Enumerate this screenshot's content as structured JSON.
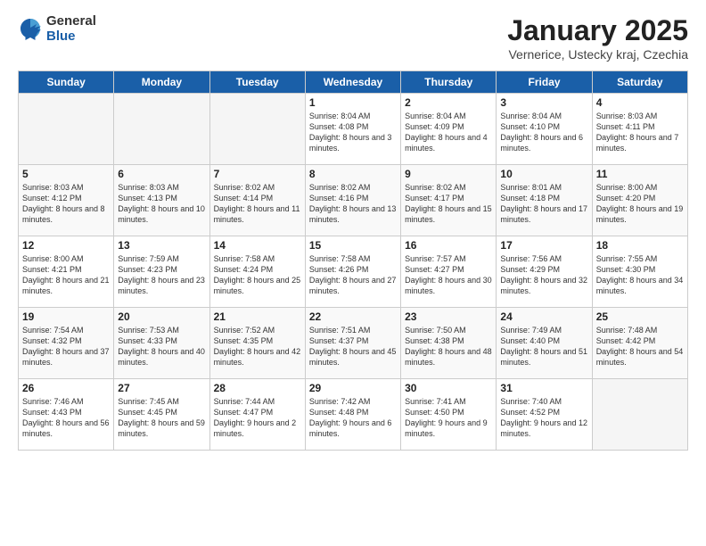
{
  "logo": {
    "general": "General",
    "blue": "Blue"
  },
  "header": {
    "title": "January 2025",
    "subtitle": "Vernerice, Ustecky kraj, Czechia"
  },
  "days_of_week": [
    "Sunday",
    "Monday",
    "Tuesday",
    "Wednesday",
    "Thursday",
    "Friday",
    "Saturday"
  ],
  "weeks": [
    [
      {
        "day": "",
        "empty": true
      },
      {
        "day": "",
        "empty": true
      },
      {
        "day": "",
        "empty": true
      },
      {
        "day": "1",
        "sunrise": "8:04 AM",
        "sunset": "4:08 PM",
        "daylight": "8 hours and 3 minutes."
      },
      {
        "day": "2",
        "sunrise": "8:04 AM",
        "sunset": "4:09 PM",
        "daylight": "8 hours and 4 minutes."
      },
      {
        "day": "3",
        "sunrise": "8:04 AM",
        "sunset": "4:10 PM",
        "daylight": "8 hours and 6 minutes."
      },
      {
        "day": "4",
        "sunrise": "8:03 AM",
        "sunset": "4:11 PM",
        "daylight": "8 hours and 7 minutes."
      }
    ],
    [
      {
        "day": "5",
        "sunrise": "8:03 AM",
        "sunset": "4:12 PM",
        "daylight": "8 hours and 8 minutes."
      },
      {
        "day": "6",
        "sunrise": "8:03 AM",
        "sunset": "4:13 PM",
        "daylight": "8 hours and 10 minutes."
      },
      {
        "day": "7",
        "sunrise": "8:02 AM",
        "sunset": "4:14 PM",
        "daylight": "8 hours and 11 minutes."
      },
      {
        "day": "8",
        "sunrise": "8:02 AM",
        "sunset": "4:16 PM",
        "daylight": "8 hours and 13 minutes."
      },
      {
        "day": "9",
        "sunrise": "8:02 AM",
        "sunset": "4:17 PM",
        "daylight": "8 hours and 15 minutes."
      },
      {
        "day": "10",
        "sunrise": "8:01 AM",
        "sunset": "4:18 PM",
        "daylight": "8 hours and 17 minutes."
      },
      {
        "day": "11",
        "sunrise": "8:00 AM",
        "sunset": "4:20 PM",
        "daylight": "8 hours and 19 minutes."
      }
    ],
    [
      {
        "day": "12",
        "sunrise": "8:00 AM",
        "sunset": "4:21 PM",
        "daylight": "8 hours and 21 minutes."
      },
      {
        "day": "13",
        "sunrise": "7:59 AM",
        "sunset": "4:23 PM",
        "daylight": "8 hours and 23 minutes."
      },
      {
        "day": "14",
        "sunrise": "7:58 AM",
        "sunset": "4:24 PM",
        "daylight": "8 hours and 25 minutes."
      },
      {
        "day": "15",
        "sunrise": "7:58 AM",
        "sunset": "4:26 PM",
        "daylight": "8 hours and 27 minutes."
      },
      {
        "day": "16",
        "sunrise": "7:57 AM",
        "sunset": "4:27 PM",
        "daylight": "8 hours and 30 minutes."
      },
      {
        "day": "17",
        "sunrise": "7:56 AM",
        "sunset": "4:29 PM",
        "daylight": "8 hours and 32 minutes."
      },
      {
        "day": "18",
        "sunrise": "7:55 AM",
        "sunset": "4:30 PM",
        "daylight": "8 hours and 34 minutes."
      }
    ],
    [
      {
        "day": "19",
        "sunrise": "7:54 AM",
        "sunset": "4:32 PM",
        "daylight": "8 hours and 37 minutes."
      },
      {
        "day": "20",
        "sunrise": "7:53 AM",
        "sunset": "4:33 PM",
        "daylight": "8 hours and 40 minutes."
      },
      {
        "day": "21",
        "sunrise": "7:52 AM",
        "sunset": "4:35 PM",
        "daylight": "8 hours and 42 minutes."
      },
      {
        "day": "22",
        "sunrise": "7:51 AM",
        "sunset": "4:37 PM",
        "daylight": "8 hours and 45 minutes."
      },
      {
        "day": "23",
        "sunrise": "7:50 AM",
        "sunset": "4:38 PM",
        "daylight": "8 hours and 48 minutes."
      },
      {
        "day": "24",
        "sunrise": "7:49 AM",
        "sunset": "4:40 PM",
        "daylight": "8 hours and 51 minutes."
      },
      {
        "day": "25",
        "sunrise": "7:48 AM",
        "sunset": "4:42 PM",
        "daylight": "8 hours and 54 minutes."
      }
    ],
    [
      {
        "day": "26",
        "sunrise": "7:46 AM",
        "sunset": "4:43 PM",
        "daylight": "8 hours and 56 minutes."
      },
      {
        "day": "27",
        "sunrise": "7:45 AM",
        "sunset": "4:45 PM",
        "daylight": "8 hours and 59 minutes."
      },
      {
        "day": "28",
        "sunrise": "7:44 AM",
        "sunset": "4:47 PM",
        "daylight": "9 hours and 2 minutes."
      },
      {
        "day": "29",
        "sunrise": "7:42 AM",
        "sunset": "4:48 PM",
        "daylight": "9 hours and 6 minutes."
      },
      {
        "day": "30",
        "sunrise": "7:41 AM",
        "sunset": "4:50 PM",
        "daylight": "9 hours and 9 minutes."
      },
      {
        "day": "31",
        "sunrise": "7:40 AM",
        "sunset": "4:52 PM",
        "daylight": "9 hours and 12 minutes."
      },
      {
        "day": "",
        "empty": true
      }
    ]
  ],
  "labels": {
    "sunrise": "Sunrise:",
    "sunset": "Sunset:",
    "daylight": "Daylight:"
  }
}
